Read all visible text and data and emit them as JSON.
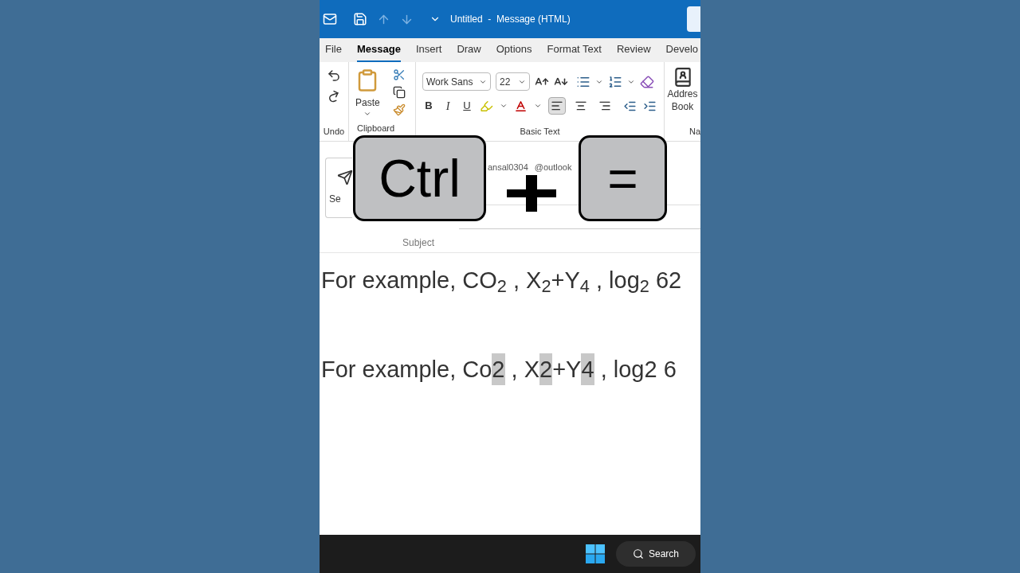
{
  "title_bar": {
    "title": "Untitled  -  Message (HTML)"
  },
  "tabs": [
    {
      "label": "File",
      "selected": false
    },
    {
      "label": "Message",
      "selected": true
    },
    {
      "label": "Insert",
      "selected": false
    },
    {
      "label": "Draw",
      "selected": false
    },
    {
      "label": "Options",
      "selected": false
    },
    {
      "label": "Format Text",
      "selected": false
    },
    {
      "label": "Review",
      "selected": false
    },
    {
      "label": "Develo",
      "selected": false
    }
  ],
  "ribbon": {
    "undo_label": "Undo",
    "paste_label": "Paste",
    "clipboard_label": "Clipboard",
    "font_name": "Work Sans",
    "font_size": "22",
    "bold": "B",
    "italic": "I",
    "underline": "U",
    "align_buttons": [
      {
        "kind": "left",
        "selected": true
      },
      {
        "kind": "center",
        "selected": false
      },
      {
        "kind": "right",
        "selected": false
      }
    ],
    "basic_text_label": "Basic Text",
    "address_book": [
      "Addres",
      "Book"
    ],
    "names_label": "Na"
  },
  "header": {
    "send_label": "Se",
    "to_text_start": "ansal0304",
    "to_text_end": "@outlook",
    "subject_label": "Subject"
  },
  "body": {
    "lines": [
      {
        "kind": "rich",
        "text": "For example, CO$_{2}$ , X$_{2}$+Y$_{4}$ , log$_{2}$ 62"
      },
      {
        "kind": "segments",
        "segments": [
          {
            "text": "For example, Co",
            "highlighted": false
          },
          {
            "text": "2",
            "highlighted": true
          },
          {
            "text": " , X",
            "highlighted": false
          },
          {
            "text": "2",
            "highlighted": true
          },
          {
            "text": "+Y",
            "highlighted": false
          },
          {
            "text": "4",
            "highlighted": true
          },
          {
            "text": " , log2 6",
            "highlighted": false
          }
        ]
      }
    ]
  },
  "keys": [
    {
      "kind": "key",
      "label": "Ctrl"
    },
    {
      "kind": "plus"
    },
    {
      "kind": "key",
      "label": "="
    }
  ],
  "taskbar": {
    "search_label": "Search"
  }
}
